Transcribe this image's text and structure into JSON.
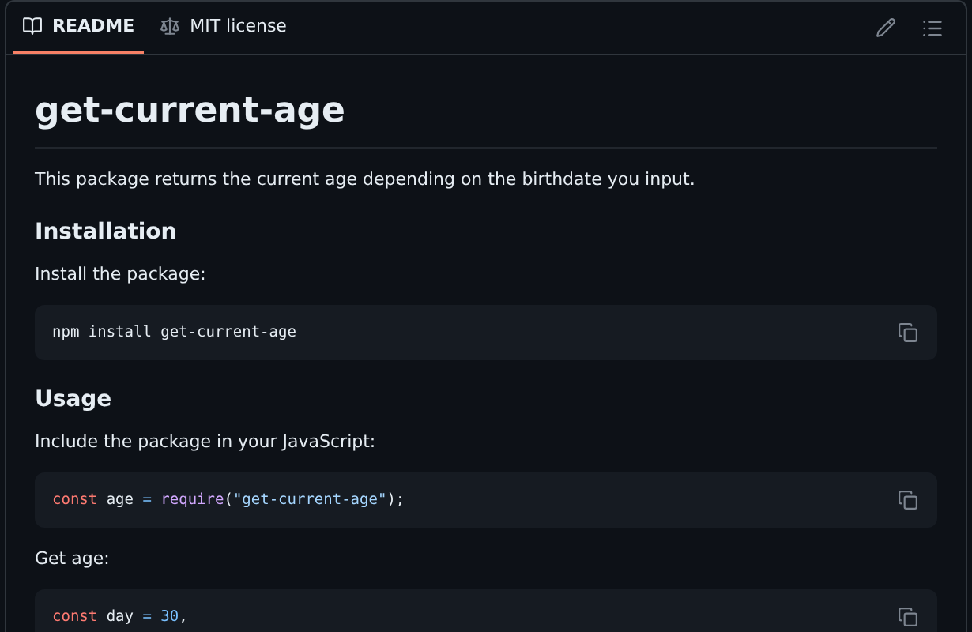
{
  "tabs": [
    {
      "label": "README",
      "selected": true
    },
    {
      "label": "MIT license",
      "selected": false
    }
  ],
  "blocks": [
    {
      "kind": "title",
      "text": "get-current-age"
    },
    {
      "kind": "paragraph",
      "text": "This package returns the current age depending on the birthdate you input."
    },
    {
      "kind": "heading",
      "text": "Installation"
    },
    {
      "kind": "paragraph",
      "text": "Install the package:"
    },
    {
      "kind": "code",
      "tokens": [
        {
          "kind": "plain",
          "text": "npm install get-current-age"
        }
      ]
    },
    {
      "kind": "heading",
      "text": "Usage"
    },
    {
      "kind": "paragraph",
      "text": "Include the package in your JavaScript:"
    },
    {
      "kind": "code",
      "tokens": [
        {
          "kind": "keyword",
          "text": "const"
        },
        {
          "kind": "plain",
          "text": " age "
        },
        {
          "kind": "operator",
          "text": "= "
        },
        {
          "kind": "function",
          "text": "require"
        },
        {
          "kind": "plain",
          "text": "("
        },
        {
          "kind": "string",
          "text": "\"get-current-age\""
        },
        {
          "kind": "plain",
          "text": ");"
        }
      ]
    },
    {
      "kind": "paragraph",
      "text": "Get age:"
    },
    {
      "kind": "code",
      "tokens": [
        {
          "kind": "keyword",
          "text": "const"
        },
        {
          "kind": "plain",
          "text": " day "
        },
        {
          "kind": "operator",
          "text": "= "
        },
        {
          "kind": "number",
          "text": "30"
        },
        {
          "kind": "plain",
          "text": ","
        }
      ]
    }
  ]
}
